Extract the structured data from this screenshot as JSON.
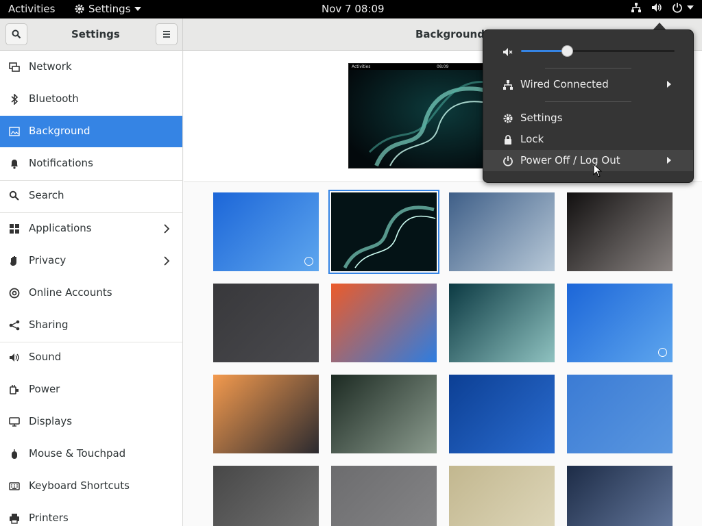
{
  "topbar": {
    "activities": "Activities",
    "app_menu": "Settings",
    "clock": "Nov 7  08:09",
    "tray_icons": [
      "network-wired-icon",
      "volume-icon",
      "power-icon"
    ]
  },
  "headerbar": {
    "sidebar_title": "Settings",
    "page_title": "Background"
  },
  "sidebar": {
    "items": [
      {
        "label": "Network",
        "icon": "network-icon"
      },
      {
        "label": "Bluetooth",
        "icon": "bluetooth-icon"
      },
      {
        "label": "Background",
        "icon": "background-icon",
        "active": true
      },
      {
        "label": "Notifications",
        "icon": "bell-icon"
      },
      {
        "label": "Search",
        "icon": "search-icon"
      },
      {
        "label": "Applications",
        "icon": "apps-icon",
        "chevron": true
      },
      {
        "label": "Privacy",
        "icon": "hand-icon",
        "chevron": true
      },
      {
        "label": "Online Accounts",
        "icon": "at-icon"
      },
      {
        "label": "Sharing",
        "icon": "share-icon"
      },
      {
        "label": "Sound",
        "icon": "speaker-icon"
      },
      {
        "label": "Power",
        "icon": "power-plug-icon"
      },
      {
        "label": "Displays",
        "icon": "display-icon"
      },
      {
        "label": "Mouse & Touchpad",
        "icon": "mouse-icon"
      },
      {
        "label": "Keyboard Shortcuts",
        "icon": "keyboard-icon"
      },
      {
        "label": "Printers",
        "icon": "printer-icon"
      }
    ]
  },
  "preview": {
    "mini_activities": "Activities",
    "mini_clock": "08:09"
  },
  "wallpapers": [
    {
      "name": "blue-geometric",
      "colors": [
        "#1c66d8",
        "#5ea6ee"
      ],
      "badge": true
    },
    {
      "name": "green-smoke",
      "colors": [
        "#041316",
        "#6fd6c2"
      ],
      "selected": true
    },
    {
      "name": "aerial-forest-snow",
      "colors": [
        "#3f5f88",
        "#b8c9d8"
      ]
    },
    {
      "name": "dark-leaves",
      "colors": [
        "#121010",
        "#8a8482"
      ]
    },
    {
      "name": "dark-texture",
      "colors": [
        "#38383b",
        "#4a4a4e"
      ]
    },
    {
      "name": "colorful-paint",
      "colors": [
        "#ec5b2a",
        "#2e7de0"
      ]
    },
    {
      "name": "teal-trees",
      "colors": [
        "#0c3a43",
        "#8fc2c0"
      ]
    },
    {
      "name": "blue-geometric-2",
      "colors": [
        "#1c66d8",
        "#5ea6ee"
      ],
      "badge": true
    },
    {
      "name": "sunset-sea",
      "colors": [
        "#f39a4e",
        "#2b2a2f"
      ]
    },
    {
      "name": "winding-road",
      "colors": [
        "#1c2a22",
        "#8c9c8f"
      ]
    },
    {
      "name": "blue-lines",
      "colors": [
        "#0c3f94",
        "#2b6dd0"
      ]
    },
    {
      "name": "light-blue",
      "colors": [
        "#3b7bd4",
        "#5a97e0"
      ]
    },
    {
      "name": "grey-dots",
      "colors": [
        "#474747",
        "#777777"
      ]
    },
    {
      "name": "grey-plain",
      "colors": [
        "#6c6c6e",
        "#878789"
      ]
    },
    {
      "name": "beige-lines",
      "colors": [
        "#c2b78f",
        "#e0d9bd"
      ]
    },
    {
      "name": "navy-shapes",
      "colors": [
        "#1d2c47",
        "#6a7ea3"
      ]
    }
  ],
  "popover": {
    "volume_level": 0.3,
    "volume_icon": "volume-muted-icon",
    "items": [
      {
        "label": "Wired Connected",
        "icon": "network-wired-icon",
        "submenu": true
      },
      {
        "label": "Settings",
        "icon": "gear-icon"
      },
      {
        "label": "Lock",
        "icon": "lock-icon"
      },
      {
        "label": "Power Off / Log Out",
        "icon": "power-icon",
        "submenu": true
      }
    ]
  },
  "colors": {
    "accent": "#3584e4",
    "topbar": "#000000",
    "popover_bg": "#353535"
  }
}
